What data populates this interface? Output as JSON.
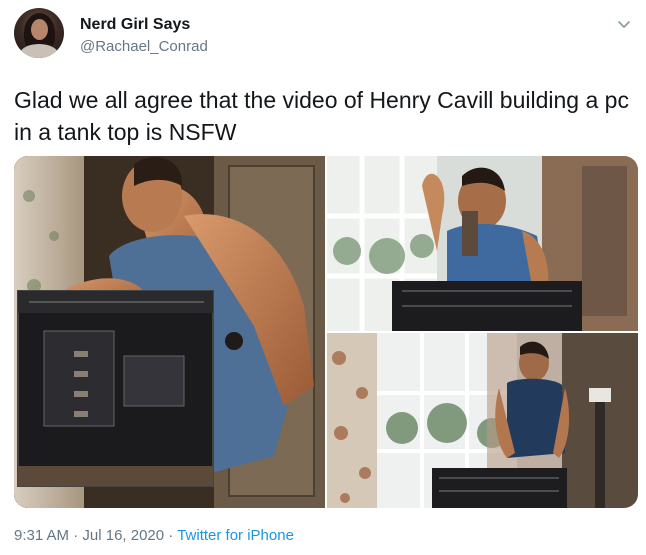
{
  "author": {
    "display_name": "Nerd Girl Says",
    "handle": "@Rachael_Conrad"
  },
  "tweet": {
    "text": "Glad we all agree that the video of Henry Cavill building a pc in a tank top is NSFW"
  },
  "meta": {
    "time": "9:31 AM",
    "separator": "·",
    "date": "Jul 16, 2020",
    "source": "Twitter for iPhone"
  },
  "icons": {
    "more": "chevron-down-icon"
  },
  "colors": {
    "text": "#14171a",
    "secondary": "#657786",
    "link": "#1b95e0"
  }
}
